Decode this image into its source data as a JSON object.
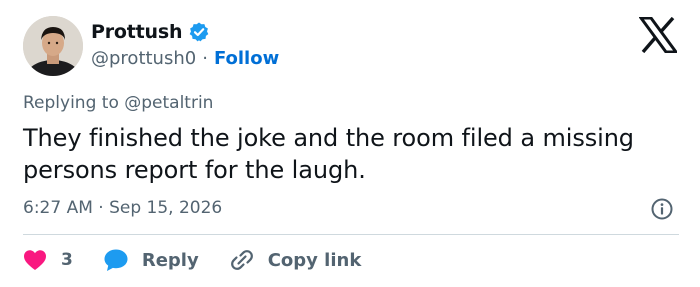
{
  "author": {
    "display_name": "Prottush",
    "handle": "@prottush0",
    "separator": "·",
    "follow_label": "Follow",
    "verified": true
  },
  "reply_context": "Replying to @petaltrin",
  "tweet_text": "They finished the joke and the room filed a missing persons report for the laugh.",
  "timestamp": "6:27 AM · Sep 15, 2026",
  "actions": {
    "likes_count": "3",
    "reply_label": "Reply",
    "copy_link_label": "Copy link"
  },
  "icons": {
    "platform_logo": "x-logo-icon",
    "verified": "verified-badge-icon",
    "info": "info-icon",
    "like": "heart-icon",
    "reply": "speech-bubble-icon",
    "copy_link": "link-icon"
  },
  "colors": {
    "text_primary": "#0f1419",
    "text_secondary": "#536471",
    "accent_blue": "#1d9bf0",
    "follow_blue": "#006fd6",
    "like_pink": "#f91880",
    "divider": "#cfd9de"
  }
}
